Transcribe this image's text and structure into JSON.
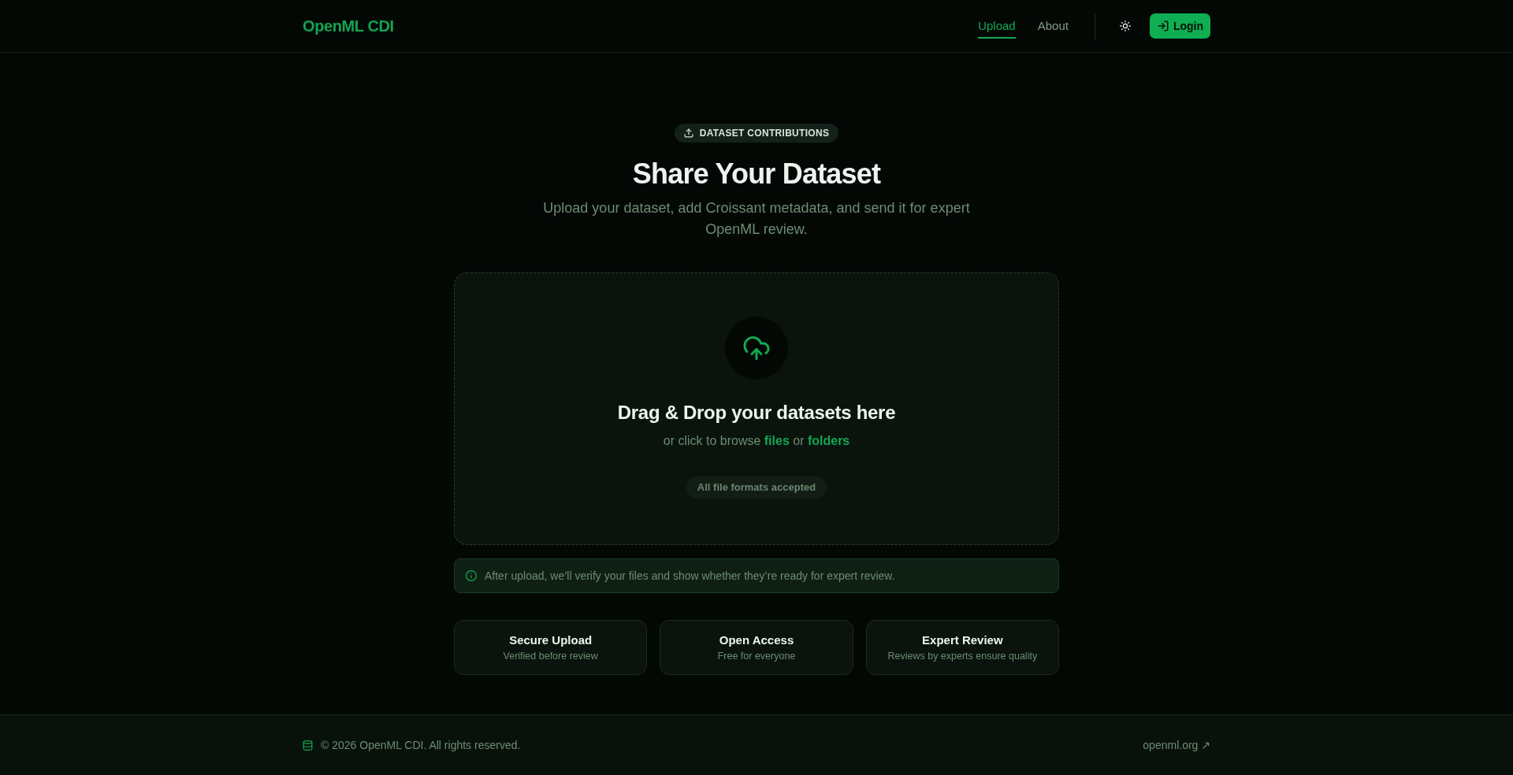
{
  "header": {
    "logo": "OpenML CDI",
    "nav": [
      {
        "label": "Upload",
        "selected": true
      },
      {
        "label": "About",
        "selected": false
      }
    ],
    "login_button": "Login"
  },
  "hero": {
    "badge": "DATASET CONTRIBUTIONS",
    "title": "Share Your Dataset",
    "subtitle": "Upload your dataset, add Croissant metadata, and send it for expert OpenML review."
  },
  "dropzone": {
    "heading": "Drag & Drop your datasets here",
    "browse_prefix": "or click to browse",
    "files_link": "files",
    "joiner": "or",
    "folders_link": "folders",
    "formats_note": "All file formats accepted"
  },
  "notice": "After upload, we’ll verify your files and show whether they’re ready for expert review.",
  "features": [
    {
      "title": "Secure Upload",
      "description": "Verified before review"
    },
    {
      "title": "Open Access",
      "description": "Free for everyone"
    },
    {
      "title": "Expert Review",
      "description": "Reviews by experts ensure quality"
    }
  ],
  "footer": {
    "copyright": "© 2026 OpenML CDI. All rights reserved.",
    "link": "openml.org ↗"
  }
}
